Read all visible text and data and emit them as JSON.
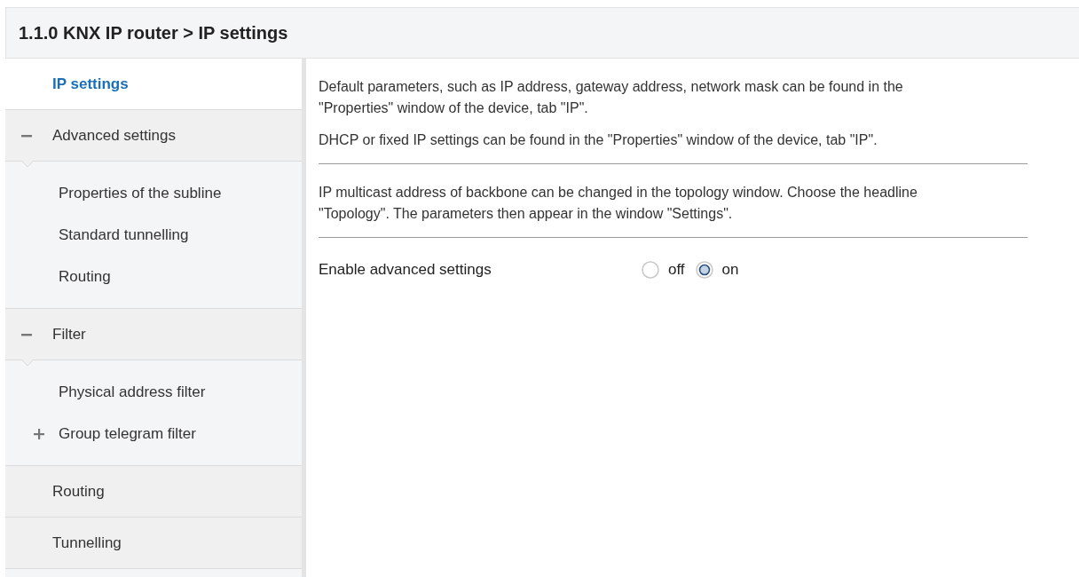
{
  "header": {
    "title": "1.1.0 KNX IP router > IP settings"
  },
  "sidebar": {
    "items": [
      {
        "kind": "page",
        "label": "IP settings",
        "selected": true
      },
      {
        "kind": "group",
        "label": "Advanced settings",
        "expanded": true,
        "selected": false,
        "children": [
          {
            "label": "Properties of the subline",
            "selected": false
          },
          {
            "label": "Standard tunnelling",
            "selected": false
          },
          {
            "label": "Routing",
            "selected": false
          }
        ]
      },
      {
        "kind": "group",
        "label": "Filter",
        "expanded": true,
        "selected": false,
        "children": [
          {
            "label": "Physical address filter",
            "selected": false
          },
          {
            "label": "Group telegram filter",
            "selected": false,
            "expanded": false
          }
        ]
      },
      {
        "kind": "page",
        "label": "Routing",
        "selected": false
      },
      {
        "kind": "page",
        "label": "Tunnelling",
        "selected": false
      }
    ]
  },
  "content": {
    "blocks": [
      {
        "kind": "text",
        "text": "Default parameters, such as IP address, gateway address, network mask can be found in the \"Properties\" window of the device, tab \"IP\"."
      },
      {
        "kind": "text",
        "text": "DHCP or fixed IP settings can be found in the \"Properties\" window of the device, tab \"IP\"."
      },
      {
        "kind": "divider"
      },
      {
        "kind": "text",
        "text": "IP multicast address of backbone can be changed in the topology window. Choose the headline \"Topology\". The parameters then appear in the window \"Settings\"."
      },
      {
        "kind": "divider"
      },
      {
        "kind": "radio",
        "label": "Enable advanced settings",
        "options": [
          {
            "label": "off",
            "selected": false
          },
          {
            "label": "on",
            "selected": true
          }
        ]
      }
    ]
  }
}
